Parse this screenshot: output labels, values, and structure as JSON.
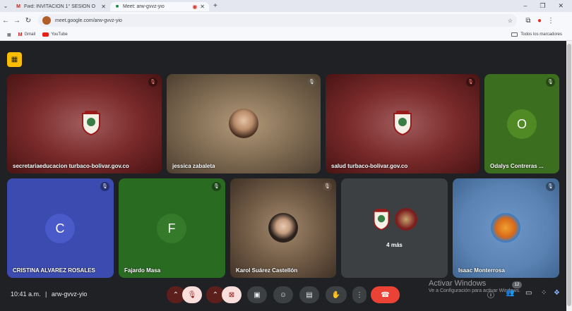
{
  "browser": {
    "tabs": [
      {
        "title": "Fwd: INVITACIÓN 1° SESIÓN O",
        "icon": "gmail-icon"
      },
      {
        "title": "Meet: arw-gvvz-yio",
        "icon": "meet-icon"
      }
    ],
    "url": "meet.google.com/arw-gvvz-yio",
    "bookmarks": [
      {
        "label": "Gmail"
      },
      {
        "label": "YouTube"
      }
    ],
    "all_bookmarks": "Todos los marcadores"
  },
  "tiles": [
    {
      "name": "secretariaeducacion turbaco-bolivar.gov.co",
      "type": "logo"
    },
    {
      "name": "jessica zabaleta",
      "type": "photo"
    },
    {
      "name": "salud turbaco-bolivar.gov.co",
      "type": "logo"
    },
    {
      "name": "Odalys Contreras ...",
      "type": "initial",
      "initial": "O"
    },
    {
      "name": "CRISTINA ALVAREZ ROSALES",
      "type": "initial",
      "initial": "C"
    },
    {
      "name": "Fajardo Masa",
      "type": "initial",
      "initial": "F"
    },
    {
      "name": "Karol Suárez Castellón",
      "type": "photo"
    },
    {
      "name": "",
      "type": "others",
      "more": "4 más"
    },
    {
      "name": "Isaac Monterrosa",
      "type": "photo"
    }
  ],
  "meeting": {
    "time": "10:41 a.m.",
    "code": "arw-gvvz-yio",
    "participants_count": "12"
  },
  "watermark": {
    "title": "Activar Windows",
    "subtitle": "Ve a Configuración para activar Windows."
  },
  "colors": {
    "meet_bg": "#202124",
    "hangup": "#ea4335",
    "layout_button": "#fbbc04"
  }
}
